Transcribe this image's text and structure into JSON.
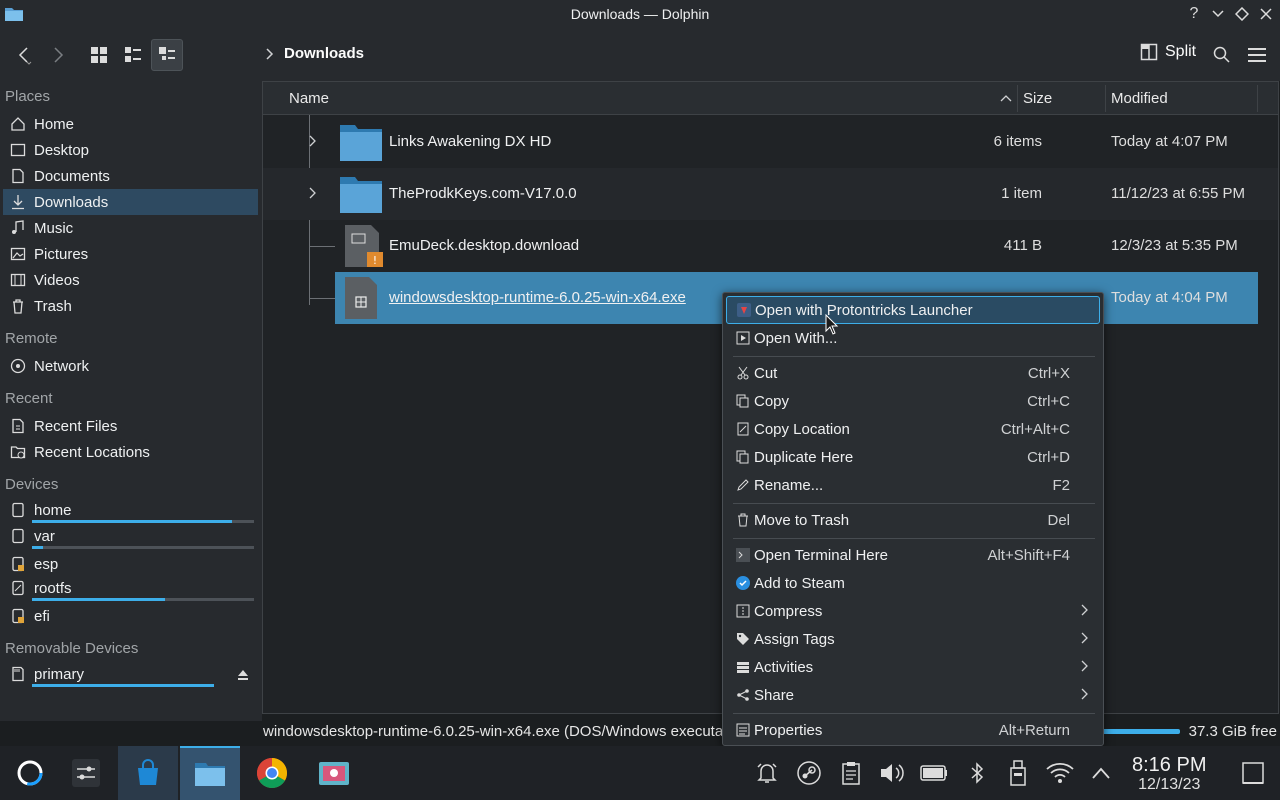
{
  "window": {
    "title": "Downloads — Dolphin",
    "controls": [
      "?",
      "minimize",
      "keep-above",
      "close"
    ]
  },
  "toolbar": {
    "breadcrumb": "Downloads",
    "split_label": "Split"
  },
  "sidebar": {
    "sections": {
      "places": "Places",
      "remote": "Remote",
      "recent": "Recent",
      "devices": "Devices",
      "removable": "Removable Devices"
    },
    "places": [
      {
        "label": "Home",
        "icon": "home-icon"
      },
      {
        "label": "Desktop",
        "icon": "desktop-icon"
      },
      {
        "label": "Documents",
        "icon": "documents-icon"
      },
      {
        "label": "Downloads",
        "icon": "downloads-icon",
        "selected": true
      },
      {
        "label": "Music",
        "icon": "music-icon"
      },
      {
        "label": "Pictures",
        "icon": "pictures-icon"
      },
      {
        "label": "Videos",
        "icon": "videos-icon"
      },
      {
        "label": "Trash",
        "icon": "trash-icon"
      }
    ],
    "remote": [
      {
        "label": "Network",
        "icon": "network-icon"
      }
    ],
    "recent": [
      {
        "label": "Recent Files",
        "icon": "recent-files-icon"
      },
      {
        "label": "Recent Locations",
        "icon": "recent-locations-icon"
      }
    ],
    "devices": [
      {
        "label": "home",
        "usage": 0.9
      },
      {
        "label": "var",
        "usage": 0.05
      },
      {
        "label": "esp"
      },
      {
        "label": "rootfs",
        "usage": 0.6
      },
      {
        "label": "efi"
      }
    ],
    "removable": [
      {
        "label": "primary",
        "usage": 0.9
      }
    ]
  },
  "view": {
    "columns": {
      "name": "Name",
      "size": "Size",
      "modified": "Modified"
    },
    "rows": [
      {
        "name": "Links Awakening DX HD",
        "size": "6 items",
        "modified": "Today at 4:07 PM",
        "type": "folder"
      },
      {
        "name": "TheProdkKeys.com-V17.0.0",
        "size": "1 item",
        "modified": "11/12/23 at 6:55 PM",
        "type": "folder"
      },
      {
        "name": "EmuDeck.desktop.download",
        "size": "411 B",
        "modified": "12/3/23 at 5:35 PM",
        "type": "file"
      },
      {
        "name": "windowsdesktop-runtime-6.0.25-win-x64.exe",
        "size": "",
        "modified": "Today at 4:04 PM",
        "type": "exe",
        "selected": true
      }
    ]
  },
  "status": {
    "text": "windowsdesktop-runtime-6.0.25-win-x64.exe (DOS/Windows executable",
    "free": "37.3 GiB free"
  },
  "context_menu": {
    "items": [
      {
        "label": "Open with Protontricks Launcher",
        "shortcut": "",
        "icon": "protontricks-icon"
      },
      {
        "label": "Open With...",
        "shortcut": "",
        "icon": "open-with-icon"
      },
      {
        "label": "Cut",
        "shortcut": "Ctrl+X",
        "icon": "cut-icon"
      },
      {
        "label": "Copy",
        "shortcut": "Ctrl+C",
        "icon": "copy-icon"
      },
      {
        "label": "Copy Location",
        "shortcut": "Ctrl+Alt+C",
        "icon": "copy-location-icon"
      },
      {
        "label": "Duplicate Here",
        "shortcut": "Ctrl+D",
        "icon": "duplicate-icon"
      },
      {
        "label": "Rename...",
        "shortcut": "F2",
        "icon": "rename-icon"
      },
      {
        "label": "Move to Trash",
        "shortcut": "Del",
        "icon": "trash-icon"
      },
      {
        "label": "Open Terminal Here",
        "shortcut": "Alt+Shift+F4",
        "icon": "terminal-icon"
      },
      {
        "label": "Add to Steam",
        "shortcut": "",
        "icon": "steam-icon"
      },
      {
        "label": "Compress",
        "shortcut": "",
        "icon": "compress-icon",
        "submenu": true
      },
      {
        "label": "Assign Tags",
        "shortcut": "",
        "icon": "tag-icon",
        "submenu": true
      },
      {
        "label": "Activities",
        "shortcut": "",
        "icon": "activities-icon",
        "submenu": true
      },
      {
        "label": "Share",
        "shortcut": "",
        "icon": "share-icon",
        "submenu": true
      },
      {
        "label": "Properties",
        "shortcut": "Alt+Return",
        "icon": "properties-icon"
      }
    ]
  },
  "taskbar": {
    "time": "8:16 PM",
    "date": "12/13/23"
  },
  "colors": {
    "accent": "#3daee9",
    "selection": "#3d85b0",
    "background": "#1b1e20"
  }
}
